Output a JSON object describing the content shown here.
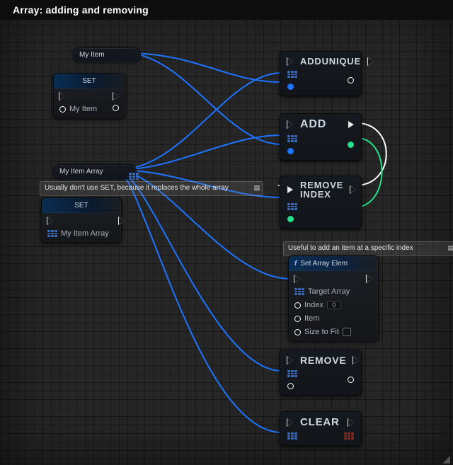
{
  "title": "Array: adding and removing",
  "vars": {
    "myItem": "My Item",
    "myItemArray": "My Item Array"
  },
  "comments": {
    "setWarning": "Usually don't use SET, because it replaces the whole array",
    "setElem": "Useful to add an item at a specific index"
  },
  "nodes": {
    "setItem": {
      "title": "SET",
      "pin": "My Item"
    },
    "setArray": {
      "title": "SET",
      "pin": "My Item Array"
    },
    "addUnique": {
      "title": "ADDUNIQUE"
    },
    "add": {
      "title": "ADD"
    },
    "removeIndex": {
      "line1": "REMOVE",
      "line2": "INDEX"
    },
    "setArrayElem": {
      "title": "Set Array Elem",
      "pins": {
        "target": "Target Array",
        "index": "Index",
        "item": "Item",
        "size": "Size to Fit"
      },
      "indexValue": "0"
    },
    "remove": {
      "title": "REMOVE"
    },
    "clear": {
      "title": "CLEAR"
    }
  }
}
